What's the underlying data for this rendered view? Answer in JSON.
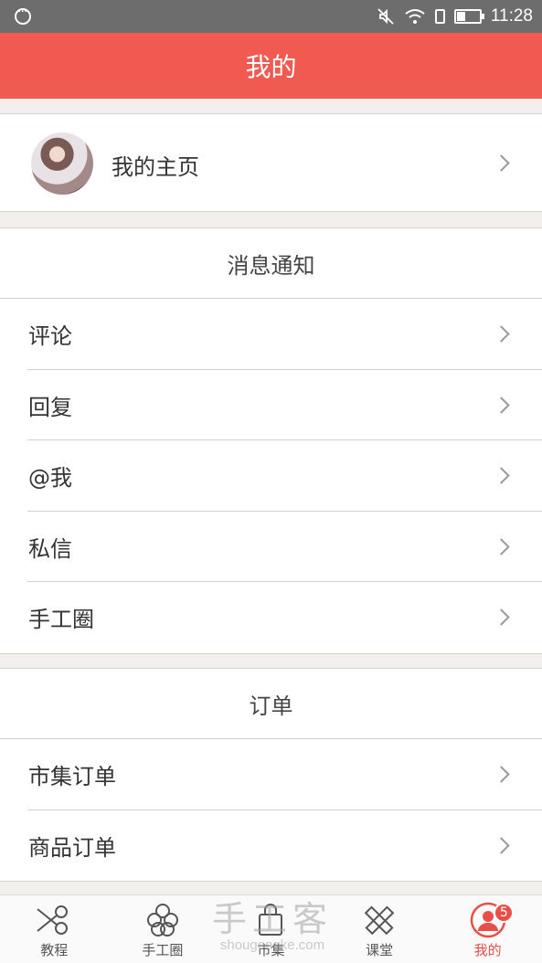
{
  "status_bar": {
    "time": "11:28"
  },
  "header": {
    "title": "我的"
  },
  "profile": {
    "label": "我的主页"
  },
  "notifications": {
    "heading": "消息通知",
    "items": [
      {
        "label": "评论"
      },
      {
        "label": "回复"
      },
      {
        "label": "@我"
      },
      {
        "label": "私信"
      },
      {
        "label": "手工圈"
      }
    ]
  },
  "orders": {
    "heading": "订单",
    "items": [
      {
        "label": "市集订单"
      },
      {
        "label": "商品订单"
      }
    ]
  },
  "tab_bar": {
    "tabs": [
      {
        "label": "教程",
        "icon": "scissors-icon"
      },
      {
        "label": "手工圈",
        "icon": "flower-icon"
      },
      {
        "label": "市集",
        "icon": "shopping-bag-icon"
      },
      {
        "label": "课堂",
        "icon": "pencil-ruler-icon"
      },
      {
        "label": "我的",
        "icon": "user-icon",
        "badge": "5",
        "active": true
      }
    ],
    "active_color": "#e94e49"
  },
  "watermark": {
    "main": "手工客",
    "sub": "shougongke.com"
  },
  "colors": {
    "header_bg": "#f15a51",
    "status_bar_bg": "#6d6d6d",
    "page_bg": "#f2efec"
  }
}
